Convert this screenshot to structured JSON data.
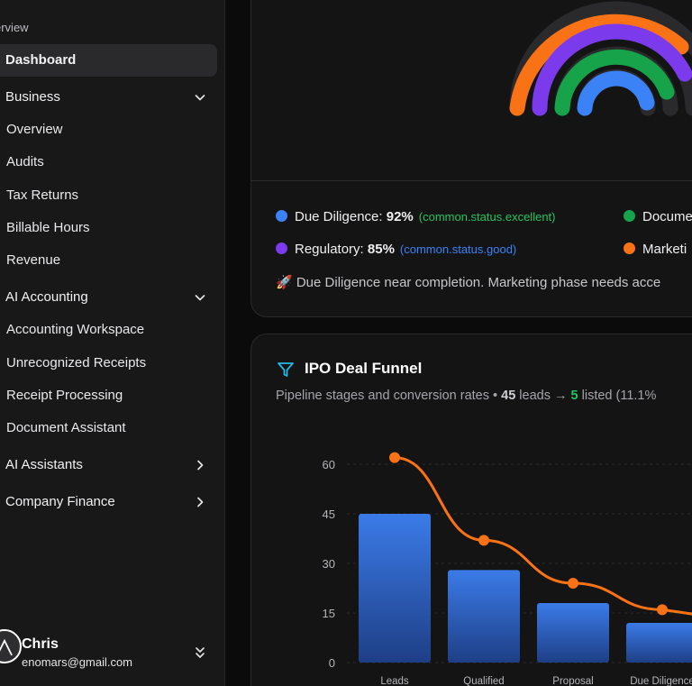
{
  "sidebar": {
    "section_label": "erview",
    "items": {
      "dashboard": "Dashboard",
      "business": "Business",
      "overview": "Overview",
      "audits": "Audits",
      "tax_returns": "Tax Returns",
      "billable_hours": "Billable Hours",
      "revenue": "Revenue",
      "ai_accounting": "AI Accounting",
      "accounting_workspace": "Accounting Workspace",
      "unrecognized_receipts": "Unrecognized Receipts",
      "receipt_processing": "Receipt Processing",
      "document_assistant": "Document Assistant",
      "ai_assistants": "AI Assistants",
      "company_finance": "Company Finance"
    },
    "user": {
      "name": "Chris",
      "email": "enomars@gmail.com"
    }
  },
  "progress": {
    "legend": [
      {
        "label": "Due Diligence:",
        "value": "92%",
        "status": "(common.status.excellent)",
        "color": "#3b82f6",
        "status_color": "#22c55e"
      },
      {
        "label": "Regulatory:",
        "value": "85%",
        "status": "(common.status.good)",
        "color": "#7c3aed",
        "status_color": "#3b82f6"
      },
      {
        "label": "Docume",
        "color": "#16a34a"
      },
      {
        "label": "Marketi",
        "color": "#f97316"
      }
    ],
    "note": "🚀 Due Diligence near completion. Marketing phase needs acce"
  },
  "funnel": {
    "title": "IPO Deal Funnel",
    "subtitle_prefix": "Pipeline stages and conversion rates • ",
    "leads_count": "45",
    "leads_word": " leads → ",
    "listed_count": "5",
    "listed_word": " listed (11.1%"
  },
  "chart_data": {
    "type": "bar",
    "categories": [
      "Leads",
      "Qualified",
      "Proposal",
      "Due Diligence"
    ],
    "series": [
      {
        "type": "bar",
        "values": [
          45,
          28,
          18,
          12
        ],
        "color": "#3b7be8"
      },
      {
        "type": "line",
        "values": [
          62,
          37,
          24,
          16
        ],
        "color": "#f97316"
      }
    ],
    "y_ticks": [
      "60",
      "45",
      "30",
      "15",
      "0"
    ],
    "ylim": [
      0,
      60
    ],
    "grid": true
  }
}
